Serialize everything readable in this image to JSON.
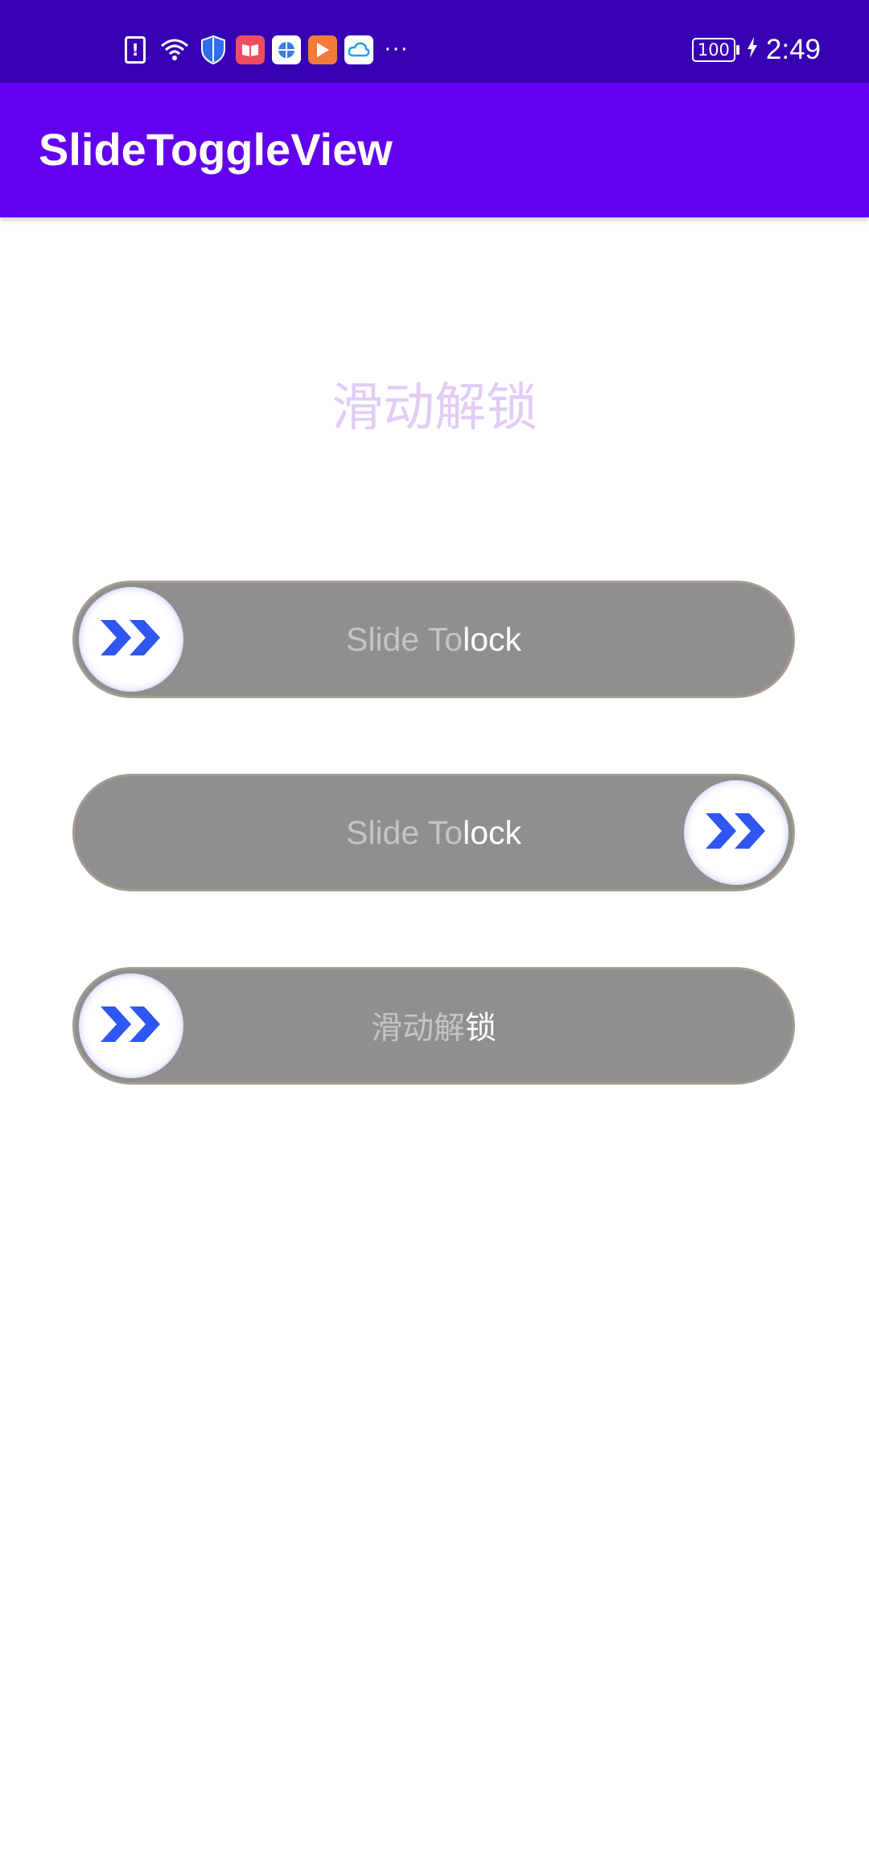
{
  "status_bar": {
    "time": "2:49",
    "battery_level": "100",
    "icons": [
      "sim-alert-icon",
      "wifi-icon",
      "shield-icon",
      "book-app-icon",
      "globe-app-icon",
      "video-app-icon",
      "cloud-app-icon",
      "more-notifications-icon"
    ],
    "more": "···",
    "colors": {
      "background": "#3700b3"
    }
  },
  "app_bar": {
    "title": "SlideToggleView",
    "colors": {
      "background": "#6200ee"
    }
  },
  "main": {
    "header_text": "滑动解锁",
    "sliders": [
      {
        "label_dim": "Slide To ",
        "label_bright": "lock",
        "thumb_position": "start",
        "progress": 0
      },
      {
        "label_dim": "Slide To ",
        "label_bright": "lock",
        "thumb_position": "end",
        "progress": 1
      },
      {
        "label_dim": "滑动解",
        "label_bright": "锁",
        "thumb_position": "start",
        "progress": 0
      }
    ],
    "thumb_icon": "double-chevron-right-icon",
    "colors": {
      "track": "#8f8f8f",
      "track_border": "#a39c91",
      "thumb": "#ffffff",
      "chevron": "#2f56f0",
      "header_text": "#e1ccf5"
    }
  }
}
